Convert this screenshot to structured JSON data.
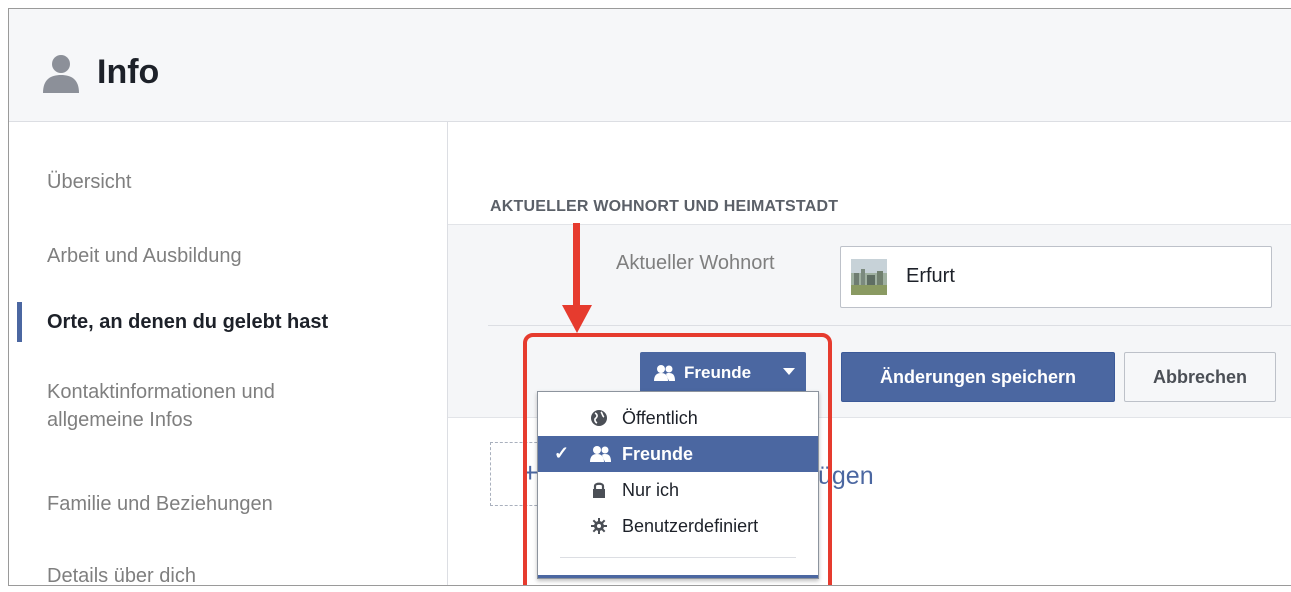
{
  "header": {
    "title": "Info",
    "icon": "person-icon"
  },
  "sidebar": {
    "items": [
      {
        "label": "Übersicht",
        "active": false
      },
      {
        "label": "Arbeit und Ausbildung",
        "active": false
      },
      {
        "label": "Orte, an denen du gelebt hast",
        "active": true
      },
      {
        "label_line1": "Kontaktinformationen und",
        "label_line2": "allgemeine Infos",
        "active": false
      },
      {
        "label": "Familie und Beziehungen",
        "active": false
      },
      {
        "label": "Details über dich",
        "active": false
      }
    ]
  },
  "main": {
    "section_title": "AKTUELLER WOHNORT UND HEIMATSTADT",
    "field": {
      "label": "Aktueller Wohnort",
      "value": "Erfurt"
    },
    "privacy_button": {
      "label": "Freunde",
      "icon": "friends-icon"
    },
    "save_label": "Änderungen speichern",
    "cancel_label": "Abbrechen",
    "add_link": {
      "plus": "+",
      "text_fragment": "ügen"
    }
  },
  "privacy_menu": {
    "items": [
      {
        "label": "Öffentlich",
        "icon": "globe-icon",
        "selected": false
      },
      {
        "label": "Freunde",
        "icon": "friends-icon",
        "selected": true
      },
      {
        "label": "Nur ich",
        "icon": "lock-icon",
        "selected": false
      },
      {
        "label": "Benutzerdefiniert",
        "icon": "gear-icon",
        "selected": false
      }
    ]
  },
  "colors": {
    "accent": "#4b67a1",
    "annotation": "#e63b2e",
    "header_bg": "#f6f7f9"
  }
}
